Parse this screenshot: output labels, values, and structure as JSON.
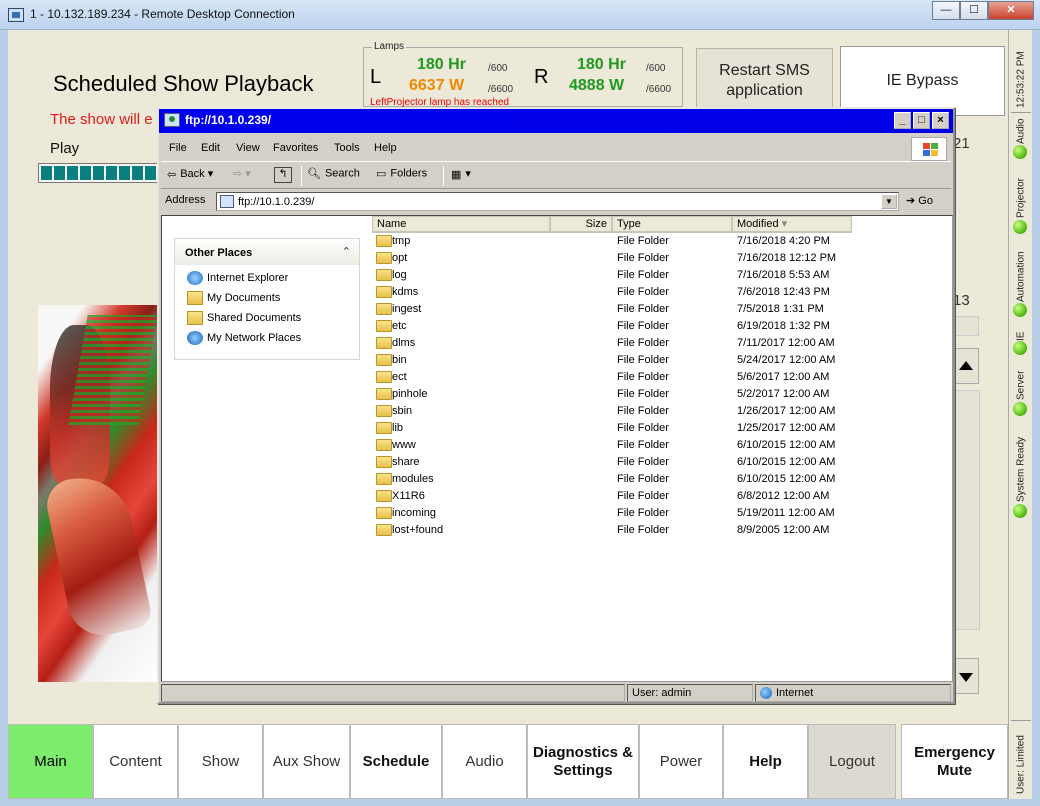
{
  "window": {
    "title": "1 - 10.132.189.234 - Remote Desktop Connection",
    "controls": [
      "—",
      "☐",
      "✕"
    ]
  },
  "status_strip": {
    "clock": "12:53:22 PM",
    "indicators": [
      "Audio",
      "Projector",
      "Automation",
      "IE",
      "Server",
      "System Ready"
    ],
    "user_role": "User: Limited",
    "led_color": "#5cc21a"
  },
  "app": {
    "page_title": "Scheduled Show Playback",
    "show_message": "The show will e",
    "play_label": "Play",
    "progress_segments": 10,
    "right_value_1": "21",
    "right_value_2": "13",
    "lamps": {
      "label": "Lamps",
      "left": {
        "side": "L",
        "hours": "180 Hr",
        "hours_max": "/600",
        "watts": "6637 W",
        "watts_max": "/6600"
      },
      "right": {
        "side": "R",
        "hours": "180 Hr",
        "hours_max": "/600",
        "watts": "4888 W",
        "watts_max": "/6600"
      },
      "warning": "LeftProjector lamp has reached"
    },
    "restart_button": "Restart SMS application",
    "ie_bypass_button": "IE Bypass"
  },
  "nav": {
    "items": [
      {
        "label": "Main",
        "active": true
      },
      {
        "label": "Content"
      },
      {
        "label": "Show"
      },
      {
        "label": "Aux Show"
      },
      {
        "label": "Schedule"
      },
      {
        "label": "Audio"
      },
      {
        "label": "Diagnostics & Settings"
      },
      {
        "label": "Power"
      },
      {
        "label": "Help"
      },
      {
        "label": "Logout"
      },
      {
        "label": "Emergency Mute"
      }
    ]
  },
  "ftp_window": {
    "title": "ftp://10.1.0.239/",
    "menu": [
      "File",
      "Edit",
      "View",
      "Favorites",
      "Tools",
      "Help"
    ],
    "toolbar": {
      "back": "Back",
      "search": "Search",
      "folders": "Folders"
    },
    "address_label": "Address",
    "address_value": "ftp://10.1.0.239/",
    "go_label": "Go",
    "other_places": {
      "title": "Other Places",
      "items": [
        "Internet Explorer",
        "My Documents",
        "Shared Documents",
        "My Network Places"
      ]
    },
    "columns": [
      "Name",
      "Size",
      "Type",
      "Modified"
    ],
    "files": [
      {
        "name": "tmp",
        "type": "File Folder",
        "modified": "7/16/2018 4:20 PM"
      },
      {
        "name": "opt",
        "type": "File Folder",
        "modified": "7/16/2018 12:12 PM"
      },
      {
        "name": "log",
        "type": "File Folder",
        "modified": "7/16/2018 5:53 AM"
      },
      {
        "name": "kdms",
        "type": "File Folder",
        "modified": "7/6/2018 12:43 PM"
      },
      {
        "name": "ingest",
        "type": "File Folder",
        "modified": "7/5/2018 1:31 PM"
      },
      {
        "name": "etc",
        "type": "File Folder",
        "modified": "6/19/2018 1:32 PM"
      },
      {
        "name": "dlms",
        "type": "File Folder",
        "modified": "7/11/2017 12:00 AM"
      },
      {
        "name": "bin",
        "type": "File Folder",
        "modified": "5/24/2017 12:00 AM"
      },
      {
        "name": "ect",
        "type": "File Folder",
        "modified": "5/6/2017 12:00 AM"
      },
      {
        "name": "pinhole",
        "type": "File Folder",
        "modified": "5/2/2017 12:00 AM"
      },
      {
        "name": "sbin",
        "type": "File Folder",
        "modified": "1/26/2017 12:00 AM"
      },
      {
        "name": "lib",
        "type": "File Folder",
        "modified": "1/25/2017 12:00 AM"
      },
      {
        "name": "www",
        "type": "File Folder",
        "modified": "6/10/2015 12:00 AM"
      },
      {
        "name": "share",
        "type": "File Folder",
        "modified": "6/10/2015 12:00 AM"
      },
      {
        "name": "modules",
        "type": "File Folder",
        "modified": "6/10/2015 12:00 AM"
      },
      {
        "name": "X11R6",
        "type": "File Folder",
        "modified": "6/8/2012 12:00 AM"
      },
      {
        "name": "incoming",
        "type": "File Folder",
        "modified": "5/19/2011 12:00 AM"
      },
      {
        "name": "lost+found",
        "type": "File Folder",
        "modified": "8/9/2005 12:00 AM"
      }
    ],
    "status": {
      "user": "User: admin",
      "zone": "Internet"
    }
  }
}
